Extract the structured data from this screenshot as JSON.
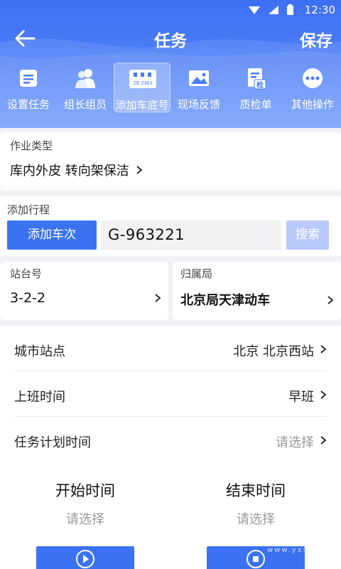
{
  "status_bar": {
    "time": "12:30"
  },
  "navbar": {
    "title": "任务",
    "save_label": "保存"
  },
  "tabs": [
    {
      "label": "设置任务",
      "icon": "settings-task-icon"
    },
    {
      "label": "组长组员",
      "icon": "team-members-icon"
    },
    {
      "label": "添加车底号",
      "icon": "train-plate-icon",
      "plate_text": "ZE 2383",
      "active": true
    },
    {
      "label": "现场反馈",
      "icon": "image-icon"
    },
    {
      "label": "质检单",
      "icon": "inspection-doc-icon",
      "badge": "检"
    },
    {
      "label": "其他操作",
      "icon": "more-icon"
    }
  ],
  "operation": {
    "label": "作业类型",
    "value": "库内外皮  转向架保洁"
  },
  "trip": {
    "label": "添加行程",
    "add_button": "添加车次",
    "train_number": "G-963221",
    "search_button": "搜索"
  },
  "station": {
    "label": "站台号",
    "value": "3-2-2"
  },
  "bureau": {
    "label": "归属局",
    "value": "北京局天津动车"
  },
  "rows": [
    {
      "label": "城市站点",
      "value": "北京  北京西站",
      "placeholder": false
    },
    {
      "label": "上班时间",
      "value": "早班",
      "placeholder": false
    },
    {
      "label": "任务计划时间",
      "value": "请选择",
      "placeholder": true
    }
  ],
  "times": {
    "start_title": "开始时间",
    "start_value": "请选择",
    "end_title": "结束时间",
    "end_value": "请选择"
  },
  "watermark": "www.yxs",
  "colors": {
    "primary": "#3b72f2",
    "header": "#4b7df7",
    "search_disabled": "#b8c9fb"
  }
}
